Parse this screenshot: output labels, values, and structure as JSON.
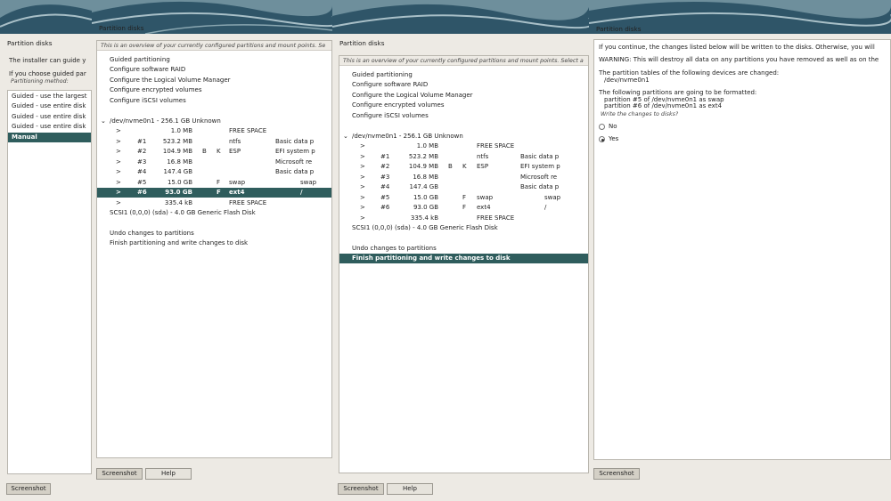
{
  "window_title": "Partition disks",
  "screenshot_label": "Screenshot",
  "help_label": "Help",
  "w1": {
    "line1": "The installer can guide y",
    "line2": "If you choose guided par",
    "method_label": "Partitioning method:",
    "options": [
      "Guided - use the largest",
      "Guided - use entire disk",
      "Guided - use entire disk",
      "Guided - use entire disk",
      "Manual"
    ]
  },
  "overview": "This is an overview of your currently configured partitions and mount points. Se",
  "overview3": "This is an overview of your currently configured partitions and mount points. Select a",
  "menu": [
    "Guided partitioning",
    "Configure software RAID",
    "Configure the Logical Volume Manager",
    "Configure encrypted volumes",
    "Configure iSCSI volumes"
  ],
  "disk": "/dev/nvme0n1 - 256.1 GB Unknown",
  "parts": [
    {
      "arrow": ">",
      "num": "",
      "size": "1.0 MB",
      "b": "",
      "k": "",
      "f": "",
      "fs": "FREE SPACE",
      "name": "",
      "mount": ""
    },
    {
      "arrow": ">",
      "num": "#1",
      "size": "523.2 MB",
      "b": "",
      "k": "",
      "f": "",
      "fs": "ntfs",
      "name": "Basic data p",
      "mount": ""
    },
    {
      "arrow": ">",
      "num": "#2",
      "size": "104.9 MB",
      "b": "B",
      "k": "K",
      "f": "",
      "fs": "ESP",
      "name": "EFI system p",
      "mount": ""
    },
    {
      "arrow": ">",
      "num": "#3",
      "size": "16.8 MB",
      "b": "",
      "k": "",
      "f": "",
      "fs": "",
      "name": "Microsoft re",
      "mount": ""
    },
    {
      "arrow": ">",
      "num": "#4",
      "size": "147.4 GB",
      "b": "",
      "k": "",
      "f": "",
      "fs": "",
      "name": "Basic data p",
      "mount": ""
    },
    {
      "arrow": ">",
      "num": "#5",
      "size": "15.0 GB",
      "b": "",
      "k": "",
      "f": "F",
      "fs": "swap",
      "name": "",
      "mount": "swap"
    },
    {
      "arrow": ">",
      "num": "#6",
      "size": "93.0 GB",
      "b": "",
      "k": "",
      "f": "F",
      "fs": "ext4",
      "name": "",
      "mount": "/"
    },
    {
      "arrow": ">",
      "num": "",
      "size": "335.4 kB",
      "b": "",
      "k": "",
      "f": "",
      "fs": "FREE SPACE",
      "name": "",
      "mount": ""
    }
  ],
  "scsi": "SCSI1 (0,0,0) (sda) - 4.0 GB Generic Flash Disk",
  "undo": "Undo changes to partitions",
  "finish": "Finish partitioning and write changes to disk",
  "w4": {
    "line1": "If you continue, the changes listed below will be written to the disks. Otherwise, you will",
    "line2": "WARNING: This will destroy all data on any partitions you have removed as well as on the",
    "line3": "The partition tables of the following devices are changed:",
    "line4": "/dev/nvme0n1",
    "line5": "The following partitions are going to be formatted:",
    "line6": "partition #5 of /dev/nvme0n1 as swap",
    "line7": "partition #6 of /dev/nvme0n1 as ext4",
    "question": "Write the changes to disks?",
    "no": "No",
    "yes": "Yes"
  }
}
